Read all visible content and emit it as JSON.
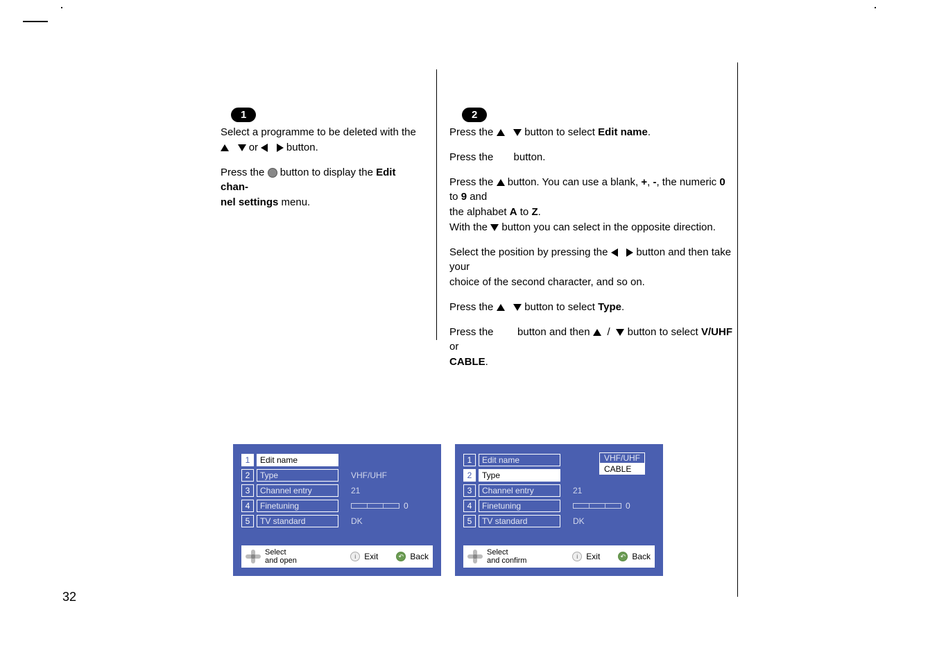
{
  "page_number": "32",
  "step1": {
    "badge": "1",
    "p1a": "Select a programme to be deleted with the",
    "p1b_or": " or ",
    "p1b_end": " button.",
    "p2a": "Press the ",
    "p2b": " button to display the ",
    "p2c": "Edit chan-",
    "p2d": "nel settings",
    "p2e": " menu."
  },
  "step2": {
    "badge": "2",
    "l1a": "Press the ",
    "l1b": " button to select ",
    "l1c": "Edit name",
    "l1d": ".",
    "l2a": "Press the ",
    "l2b": " button.",
    "l3a": "Press the ",
    "l3b": " button. You can use a blank, ",
    "l3c": "+",
    "l3d": ", ",
    "l3e": "-",
    "l3f": ", the numeric ",
    "l3g": "0",
    "l3h": " to ",
    "l3i": "9",
    "l3j": " and",
    "l4a": "the alphabet ",
    "l4b": "A",
    "l4c": " to ",
    "l4d": "Z",
    "l4e": ".",
    "l5a": "With the ",
    "l5b": " button you can select in the opposite direction.",
    "l6a": "Select the position by pressing the ",
    "l6b": " button and then take your",
    "l7": "choice of the second character, and so on.",
    "l8a": "Press the ",
    "l8b": " button to select ",
    "l8c": "Type",
    "l8d": ".",
    "l9a": "Press the ",
    "l9b": " button and then ",
    "l9c": " button to select ",
    "l9d": "V/UHF",
    "l9e": " or",
    "l10": "CABLE",
    "l10b": "."
  },
  "menu_left": {
    "rows": [
      {
        "num": "1",
        "label": "Edit name",
        "sel": true,
        "val": ""
      },
      {
        "num": "2",
        "label": "Type",
        "val": "VHF/UHF"
      },
      {
        "num": "3",
        "label": "Channel entry",
        "val": "21"
      },
      {
        "num": "4",
        "label": "Finetuning",
        "slider": "0"
      },
      {
        "num": "5",
        "label": "TV standard",
        "val": "DK"
      }
    ],
    "hint_select1": "Select",
    "hint_select2": "and open",
    "hint_exit": "Exit",
    "hint_back": "Back"
  },
  "menu_right": {
    "rows": [
      {
        "num": "1",
        "label": "Edit name",
        "val": ""
      },
      {
        "num": "2",
        "label": "Type",
        "sel": true,
        "dropdown": [
          "VHF/UHF",
          "CABLE"
        ]
      },
      {
        "num": "3",
        "label": "Channel entry",
        "val": "21"
      },
      {
        "num": "4",
        "label": "Finetuning",
        "slider": "0"
      },
      {
        "num": "5",
        "label": "TV standard",
        "val": "DK"
      }
    ],
    "hint_select1": "Select",
    "hint_select2": "and confirm",
    "hint_exit": "Exit",
    "hint_back": "Back"
  }
}
